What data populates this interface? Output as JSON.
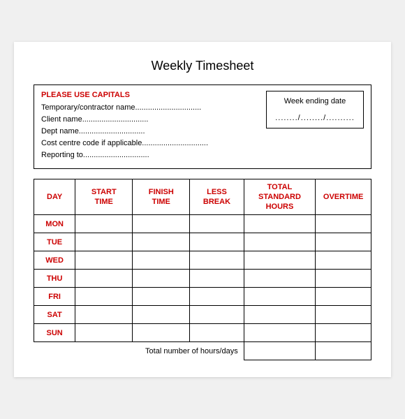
{
  "page": {
    "title": "Weekly Timesheet",
    "infoBox": {
      "header": "PLEASE USE CAPITALS",
      "fields": [
        "Temporary/contractor name...............................",
        "Client name...............................",
        "Dept name...............................",
        "Cost centre code if applicable...............................",
        "Reporting to..............................."
      ],
      "weekEndingLabel": "Week ending date",
      "weekEndingValue": "......../......../.........."
    },
    "table": {
      "headers": [
        "DAY",
        "START TIME",
        "FINISH TIME",
        "LESS BREAK",
        "TOTAL STANDARD HOURS",
        "OVERTIME"
      ],
      "days": [
        "MON",
        "TUE",
        "WED",
        "THU",
        "FRI",
        "SAT",
        "SUN"
      ],
      "totalLabel": "Total number of hours/days"
    }
  }
}
